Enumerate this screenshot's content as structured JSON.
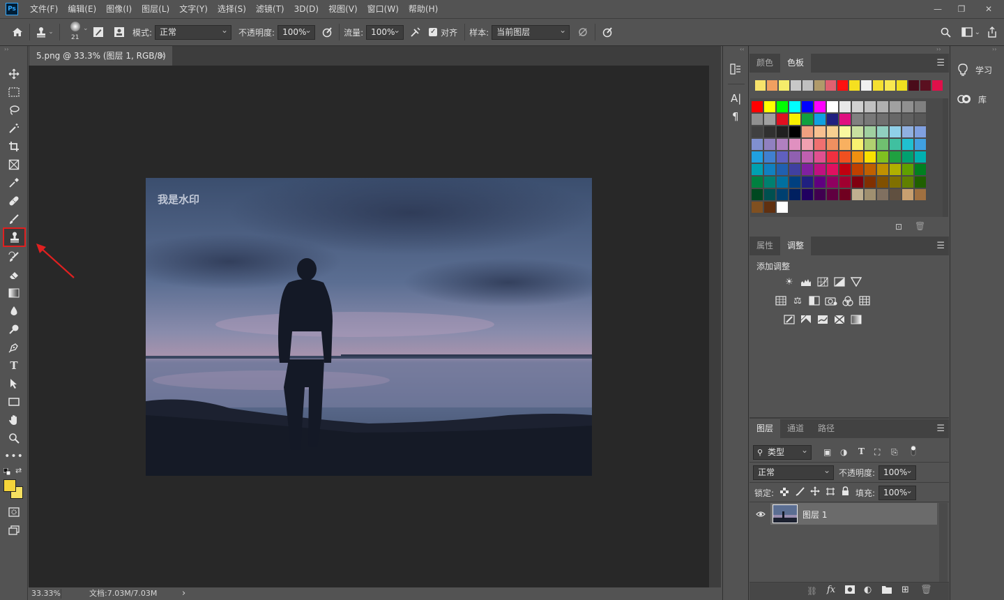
{
  "app": {
    "logo": "Ps"
  },
  "menu": [
    "文件(F)",
    "编辑(E)",
    "图像(I)",
    "图层(L)",
    "文字(Y)",
    "选择(S)",
    "滤镜(T)",
    "3D(D)",
    "视图(V)",
    "窗口(W)",
    "帮助(H)"
  ],
  "window_controls": {
    "minimize": "—",
    "restore": "❐",
    "close": "✕"
  },
  "options": {
    "brush_size": "21",
    "mode_label": "模式:",
    "mode_value": "正常",
    "opacity_label": "不透明度:",
    "opacity_value": "100%",
    "flow_label": "流量:",
    "flow_value": "100%",
    "aligned_label": "对齐",
    "aligned_checked": "✓",
    "sample_label": "样本:",
    "sample_value": "当前图层"
  },
  "document": {
    "tab_title": "5.png @ 33.3% (图层 1, RGB/8)",
    "tab_close": "×",
    "watermark": "我是水印",
    "zoom": "33.33%",
    "doc_size": "文档:7.03M/7.03M",
    "status_arrow": "›"
  },
  "toolbar": {
    "selected_tool": "clone-stamp",
    "foreground_color": "#f5d43a",
    "background_color": "#f5e060"
  },
  "panels": {
    "color_tabs": [
      "颜色",
      "色板"
    ],
    "color_active_tab": "色板",
    "adjust_tabs": [
      "属性",
      "调整"
    ],
    "adjust_active_tab": "调整",
    "add_adjustment": "添加调整",
    "layers_tabs": [
      "图层",
      "通道",
      "路径"
    ],
    "layers_active_tab": "图层",
    "filter_kind": "类型",
    "blend_mode": "正常",
    "opacity_label": "不透明度:",
    "opacity_value": "100%",
    "lock_label": "锁定:",
    "fill_label": "填充:",
    "fill_value": "100%",
    "layer_name": "图层 1"
  },
  "right_strip": {
    "learn": "学习",
    "libraries": "库"
  },
  "swatches": {
    "recent": [
      "#f7e26b",
      "#f0a060",
      "#f5ec6a",
      "#c8c8c8",
      "#c0c0c0",
      "#b09a6a",
      "#e06070",
      "#ff1010",
      "#f5e020",
      "#f0f0f0",
      "#f5e030",
      "#f8e850",
      "#f0e020",
      "#4a0c1a",
      "#5a1020",
      "#e0104a"
    ],
    "grid": [
      [
        "#ff0000",
        "#ffff00",
        "#00ff00",
        "#00ffff",
        "#0000ff",
        "#ff00ff",
        "#ffffff",
        "#e8e8e8",
        "#d0d0d0",
        "#c0c0c0",
        "#b0b0b0",
        "#a0a0a0",
        "#909090",
        "#808080"
      ],
      [
        "#909090",
        "#a0a0a0",
        "#e01020",
        "#f8f000",
        "#10a040",
        "#10a0e0",
        "#202080",
        "#e01080",
        "#808080",
        "#787878",
        "#707070",
        "#686868",
        "#606060",
        "#585858"
      ],
      [
        "#404040",
        "#303030",
        "#202020",
        "#000000",
        "#f0a080",
        "#f8c090",
        "#f8d090",
        "#f8f8a0",
        "#c8e0a0",
        "#a0d0a0",
        "#90d0c0",
        "#90d0e8",
        "#90b0e0",
        "#80a0e0"
      ],
      [
        "#8090d0",
        "#9080c0",
        "#b080c0",
        "#e090c0",
        "#f0a0b0",
        "#f07070",
        "#f09060",
        "#f8b060",
        "#f8f070",
        "#b0d070",
        "#70c070",
        "#40c0a0",
        "#20c0d0",
        "#40a0e0"
      ],
      [
        "#20a0e0",
        "#4080d0",
        "#6060c0",
        "#9060b0",
        "#c060b0",
        "#e05090",
        "#f03040",
        "#f05020",
        "#f09010",
        "#f8e000",
        "#80c020",
        "#20a040",
        "#00a070",
        "#00b0b0"
      ],
      [
        "#00a0b0",
        "#1080c0",
        "#2060b0",
        "#4040a0",
        "#8020a0",
        "#c01080",
        "#e01060",
        "#c00010",
        "#c04000",
        "#c06000",
        "#c09000",
        "#b0b000",
        "#60a000",
        "#008020"
      ],
      [
        "#008040",
        "#008070",
        "#0070a0",
        "#004080",
        "#202080",
        "#600080",
        "#900060",
        "#a00030",
        "#800010",
        "#803000",
        "#805000",
        "#807000",
        "#608000",
        "#206000"
      ],
      [
        "#004820",
        "#005050",
        "#004070",
        "#002060",
        "#200060",
        "#400050",
        "#600040",
        "#700020",
        "#c0b090",
        "#a09070",
        "#807060",
        "#605040",
        "#c8a070",
        "#a07040"
      ],
      [
        "#805020",
        "#603010",
        "#ffffff"
      ]
    ]
  }
}
